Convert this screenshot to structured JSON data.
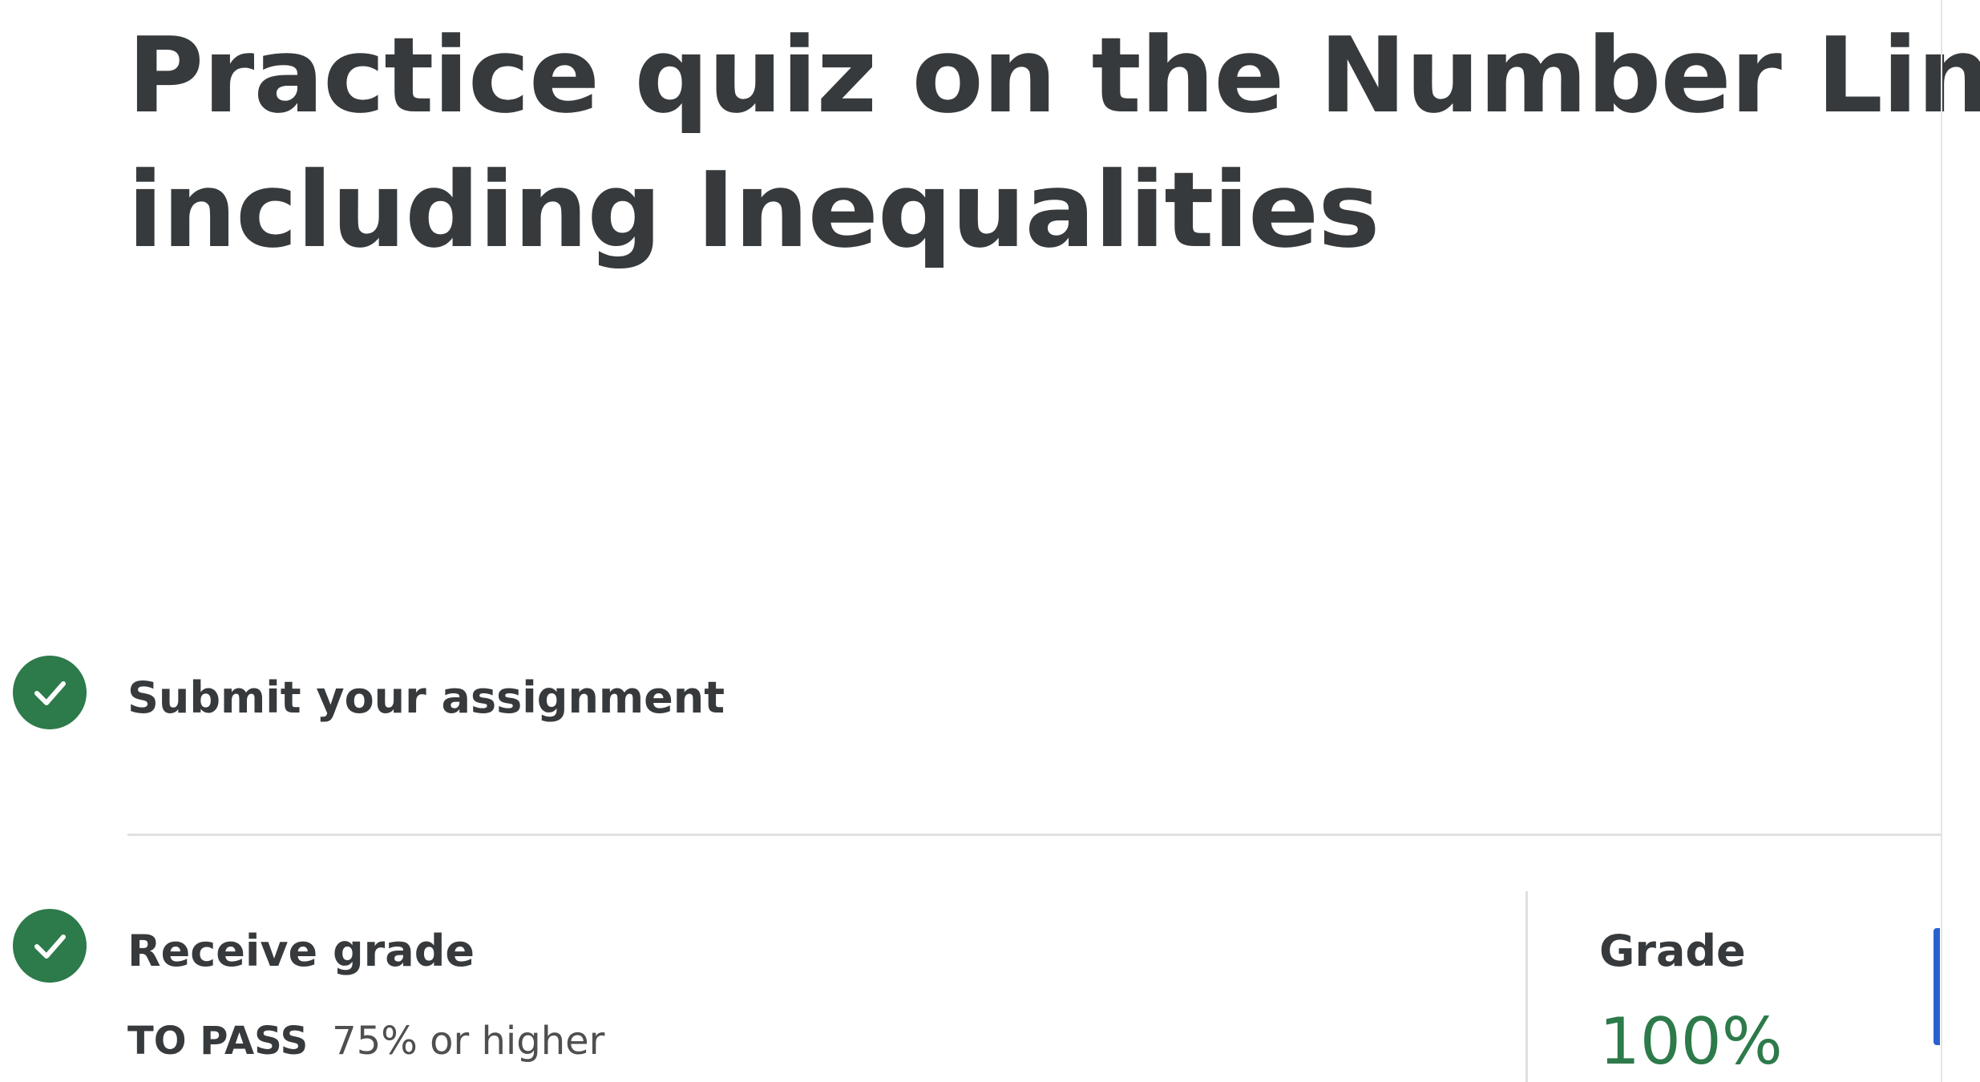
{
  "page": {
    "title_line1": "Practice quiz on the Number Line",
    "title_line2": "including Inequalities"
  },
  "steps": [
    {
      "label": "Submit your assignment",
      "icon": "check-circle-icon",
      "completed": true
    },
    {
      "label": "Receive grade",
      "icon": "check-circle-icon",
      "completed": true
    }
  ],
  "requirement": {
    "key": "TO PASS",
    "value": "75% or higher"
  },
  "grade": {
    "label": "Grade",
    "value": "100%"
  },
  "colors": {
    "success": "#2d7a4a",
    "text": "#373a3c",
    "accent": "#2a5fd0"
  }
}
